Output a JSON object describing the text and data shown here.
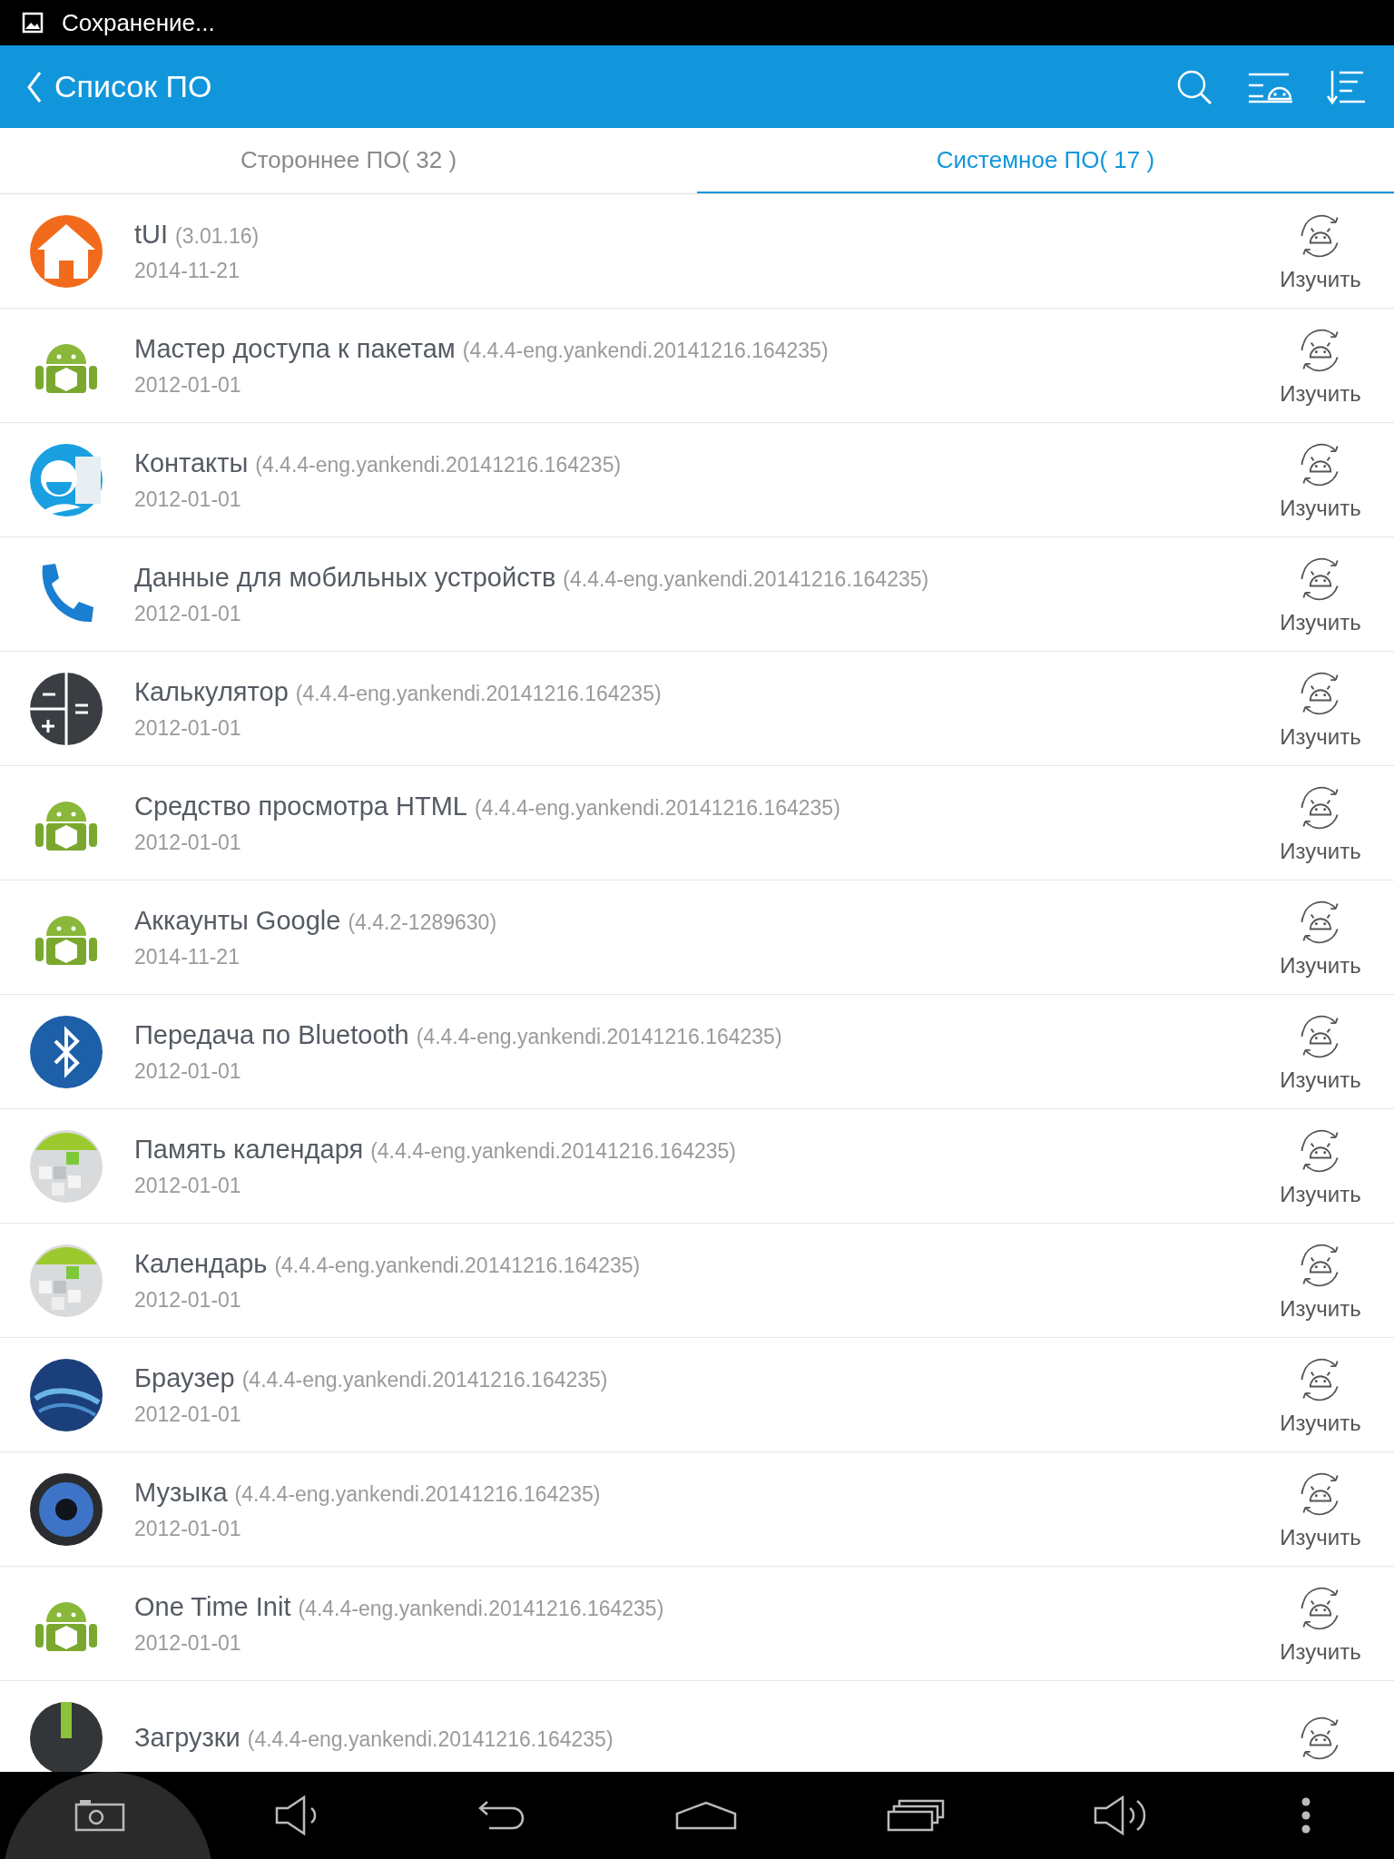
{
  "status_bar": {
    "notification": "Сохранение..."
  },
  "header": {
    "title": "Список ПО"
  },
  "tabs": [
    {
      "label": "Стороннее ПО( 32 )",
      "selected": false
    },
    {
      "label": "Системное ПО( 17 )",
      "selected": true
    }
  ],
  "apps": [
    {
      "kind": "home",
      "name": "tUI",
      "version": "(3.01.16)",
      "date": "2014-11-21",
      "action": "Изучить"
    },
    {
      "kind": "android",
      "name": "Мастер доступа к пакетам",
      "version": "(4.4.4-eng.yankendi.20141216.164235)",
      "date": "2012-01-01",
      "action": "Изучить"
    },
    {
      "kind": "contacts",
      "name": "Контакты",
      "version": "(4.4.4-eng.yankendi.20141216.164235)",
      "date": "2012-01-01",
      "action": "Изучить"
    },
    {
      "kind": "phone",
      "name": "Данные для мобильных устройств",
      "version": "(4.4.4-eng.yankendi.20141216.164235)",
      "date": "2012-01-01",
      "action": "Изучить"
    },
    {
      "kind": "calculator",
      "name": "Калькулятор",
      "version": "(4.4.4-eng.yankendi.20141216.164235)",
      "date": "2012-01-01",
      "action": "Изучить"
    },
    {
      "kind": "android",
      "name": "Средство просмотра HTML",
      "version": "(4.4.4-eng.yankendi.20141216.164235)",
      "date": "2012-01-01",
      "action": "Изучить"
    },
    {
      "kind": "android",
      "name": "Аккаунты Google",
      "version": "(4.4.2-1289630)",
      "date": "2014-11-21",
      "action": "Изучить"
    },
    {
      "kind": "bluetooth",
      "name": "Передача по Bluetooth",
      "version": "(4.4.4-eng.yankendi.20141216.164235)",
      "date": "2012-01-01",
      "action": "Изучить"
    },
    {
      "kind": "calendar",
      "name": "Память календаря",
      "version": "(4.4.4-eng.yankendi.20141216.164235)",
      "date": "2012-01-01",
      "action": "Изучить"
    },
    {
      "kind": "calendar",
      "name": "Календарь",
      "version": "(4.4.4-eng.yankendi.20141216.164235)",
      "date": "2012-01-01",
      "action": "Изучить"
    },
    {
      "kind": "browser",
      "name": "Браузер",
      "version": "(4.4.4-eng.yankendi.20141216.164235)",
      "date": "2012-01-01",
      "action": "Изучить"
    },
    {
      "kind": "music",
      "name": "Музыка",
      "version": "(4.4.4-eng.yankendi.20141216.164235)",
      "date": "2012-01-01",
      "action": "Изучить"
    },
    {
      "kind": "android",
      "name": "One Time Init",
      "version": "(4.4.4-eng.yankendi.20141216.164235)",
      "date": "2012-01-01",
      "action": "Изучить"
    },
    {
      "kind": "downloads",
      "name": "Загрузки",
      "version": "(4.4.4-eng.yankendi.20141216.164235)"
    }
  ]
}
